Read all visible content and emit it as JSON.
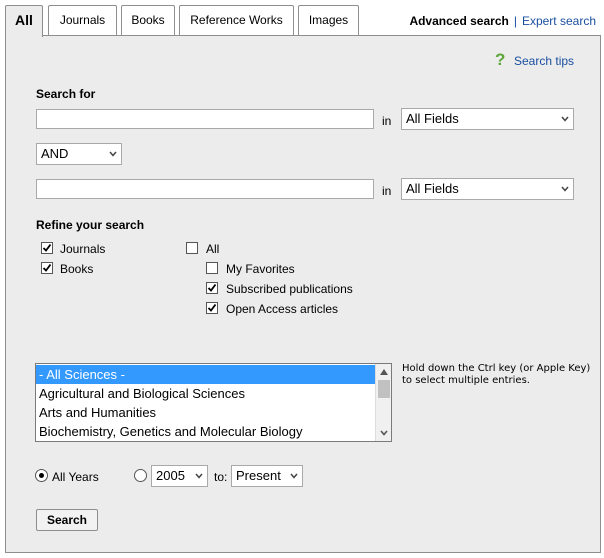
{
  "tabs": [
    {
      "label": "All",
      "active": true
    },
    {
      "label": "Journals",
      "active": false
    },
    {
      "label": "Books",
      "active": false
    },
    {
      "label": "Reference Works",
      "active": false
    },
    {
      "label": "Images",
      "active": false
    }
  ],
  "top_links": {
    "advanced": "Advanced search",
    "separator": "|",
    "expert": "Expert search"
  },
  "search_tips": {
    "icon": "question-mark-icon",
    "icon_glyph": "?",
    "label": "Search tips"
  },
  "search_for": {
    "label": "Search for",
    "row1": {
      "value": "",
      "in_label": "in",
      "field": "All Fields"
    },
    "operator": "AND",
    "row2": {
      "value": "",
      "in_label": "in",
      "field": "All Fields"
    }
  },
  "refine": {
    "label": "Refine your search",
    "left": [
      {
        "label": "Journals",
        "checked": true
      },
      {
        "label": "Books",
        "checked": true
      }
    ],
    "right_all": {
      "label": "All",
      "checked": false
    },
    "right": [
      {
        "label": "My Favorites",
        "checked": false
      },
      {
        "label": "Subscribed publications",
        "checked": true
      },
      {
        "label": "Open Access articles",
        "checked": true
      }
    ]
  },
  "subjects": {
    "items": [
      "- All Sciences -",
      "Agricultural and Biological Sciences",
      "Arts and Humanities",
      "Biochemistry, Genetics and Molecular Biology"
    ],
    "selected_index": 0,
    "hint": "Hold down the Ctrl key (or Apple Key) to select multiple entries."
  },
  "years": {
    "all_years_label": "All Years",
    "all_years_selected": true,
    "from": "2005",
    "to_label": "to:",
    "to": "Present"
  },
  "search_button": "Search",
  "colors": {
    "panel": "#ececec",
    "link": "#1a4fa0",
    "selection": "#3399ff",
    "tips_icon": "#5fa63a"
  }
}
